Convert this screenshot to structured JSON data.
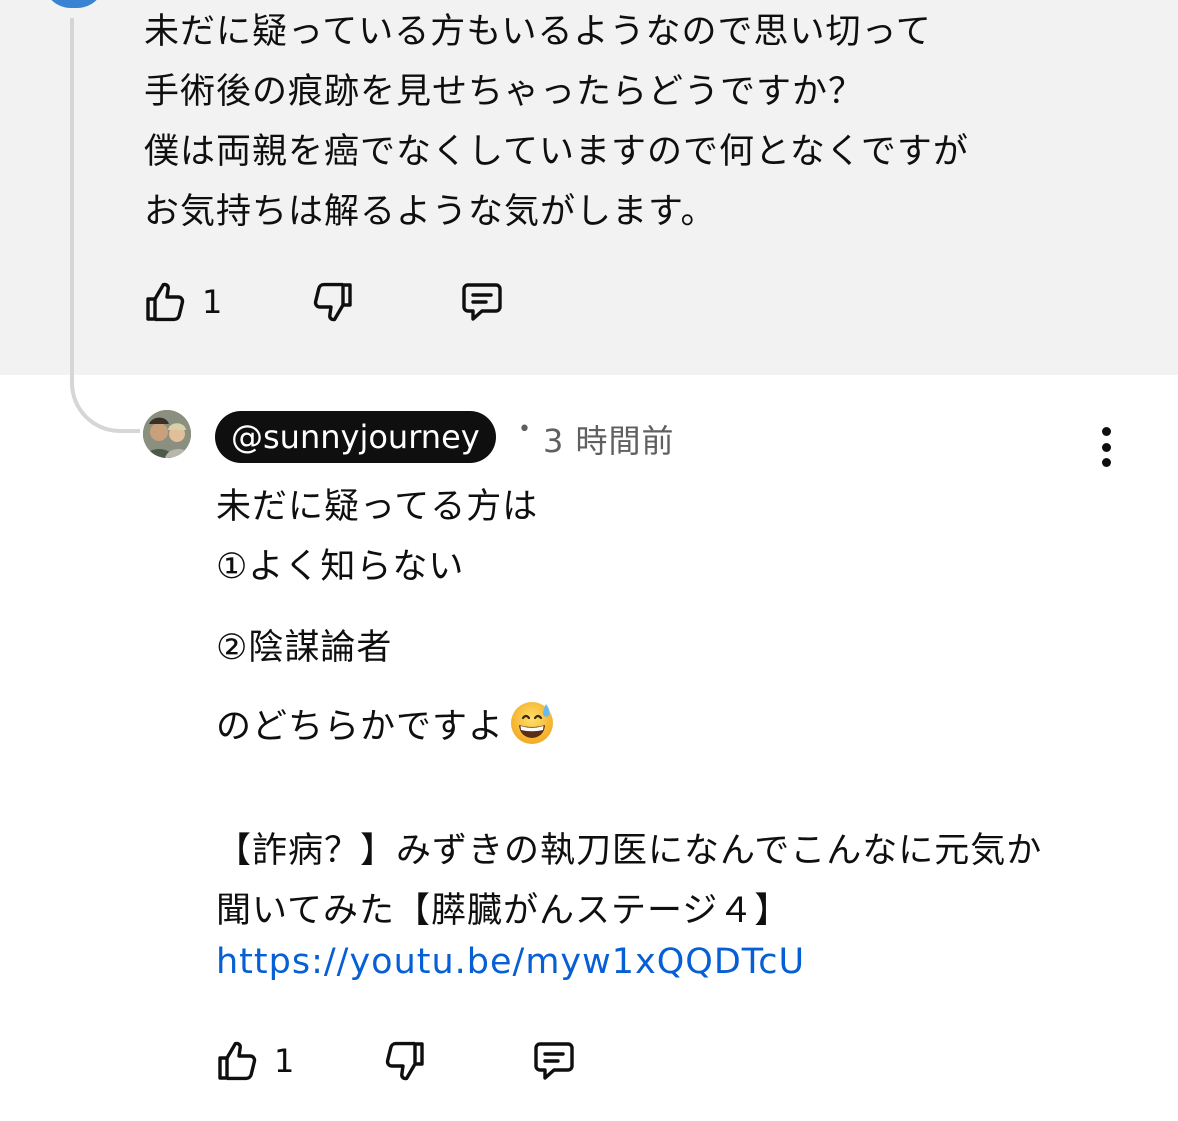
{
  "parent_comment": {
    "lines": [
      "未だに疑っている方もいるようなので思い切って",
      "手術後の痕跡を見せちゃったらどうですか？",
      "僕は両親を癌でなくしていますので何となくですが",
      "お気持ちは解るような気がします。"
    ],
    "like_count": "1"
  },
  "reply": {
    "handle": "@sunnyjourney",
    "separator": "•",
    "time": "3 時間前",
    "lines": [
      "未だに疑ってる方は",
      "①よく知らない",
      "②陰謀論者",
      "のどちらかですよ",
      "【詐病？】みずきの執刀医になんでこんなに元気か",
      "聞いてみた【膵臓がんステージ４】"
    ],
    "emoji": "grinning-face-with-sweat",
    "link": "https://youtu.be/myw1xQQDTcU",
    "like_count": "1"
  },
  "colors": {
    "highlight_bg": "#f2f2f2",
    "link": "#065fd4",
    "handle_bg": "#0f0f0f",
    "meta": "#606060",
    "thread_line": "#d6d6d6"
  },
  "icons": {
    "like": "thumbs-up-icon",
    "dislike": "thumbs-down-icon",
    "reply": "comment-reply-icon",
    "more": "more-vert-icon"
  }
}
